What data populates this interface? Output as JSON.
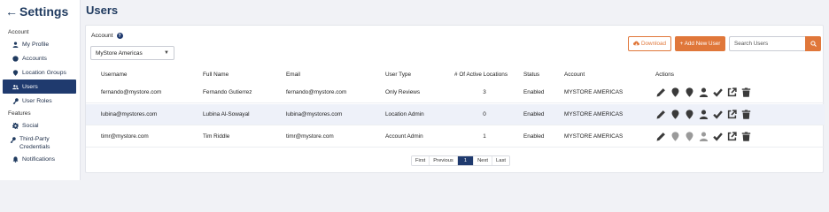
{
  "sidebar": {
    "title": "Settings",
    "sections": [
      {
        "label": "Account"
      },
      {
        "label": "Features"
      }
    ],
    "items": [
      {
        "label": "My Profile",
        "icon": "user-icon"
      },
      {
        "label": "Accounts",
        "icon": "globe-icon"
      },
      {
        "label": "Location Groups",
        "icon": "map-pin-icon"
      },
      {
        "label": "Users",
        "icon": "users-icon",
        "active": true
      },
      {
        "label": "User Roles",
        "icon": "key-icon"
      },
      {
        "label": "Social",
        "icon": "gear-icon"
      },
      {
        "label": "Third-Party Credentials",
        "icon": "key-icon"
      },
      {
        "label": "Notifications",
        "icon": "bell-icon"
      }
    ]
  },
  "page": {
    "title": "Users"
  },
  "filters": {
    "account_label": "Account",
    "account_selected": "MyStore Americas"
  },
  "toolbar": {
    "download_label": "Download",
    "add_label": "+ Add New User",
    "search_placeholder": "Search Users"
  },
  "table": {
    "headers": [
      "Username",
      "Full Name",
      "Email",
      "User Type",
      "# Of Active Locations",
      "Status",
      "Account",
      "Actions"
    ],
    "rows": [
      {
        "username": "fernando@mystore.com",
        "full_name": "Fernando Gutierrez",
        "email": "fernando@mystore.com",
        "user_type": "Only Reviews",
        "locations": "3",
        "status": "Enabled",
        "account": "MYSTORE AMERICAS"
      },
      {
        "username": "lubina@mystores.com",
        "full_name": "Lubina Al-Sowayal",
        "email": "lubina@mystores.com",
        "user_type": "Location Admin",
        "locations": "0",
        "status": "Enabled",
        "account": "MYSTORE AMERICAS"
      },
      {
        "username": "timr@mystore.com",
        "full_name": "Tim Riddle",
        "email": "timr@mystore.com",
        "user_type": "Account Admin",
        "locations": "1",
        "status": "Enabled",
        "account": "MYSTORE AMERICAS"
      }
    ]
  },
  "pagination": {
    "first": "First",
    "previous": "Previous",
    "current": "1",
    "next": "Next",
    "last": "Last"
  },
  "colors": {
    "primary": "#1f3a6e",
    "accent": "#e0773a",
    "row_highlight": "#eef1f9"
  }
}
